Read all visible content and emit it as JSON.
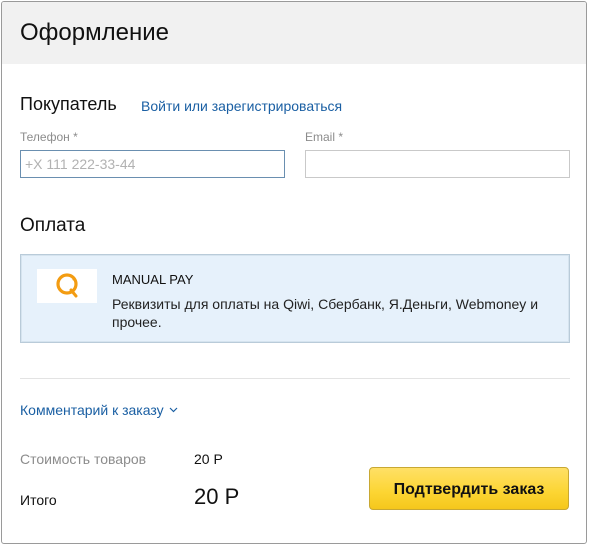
{
  "header": {
    "title": "Оформление"
  },
  "buyer": {
    "title": "Покупатель",
    "login_link": "Войти или зарегистрироваться",
    "phone": {
      "label": "Телефон *",
      "placeholder": "+X 111 222-33-44",
      "value": ""
    },
    "email": {
      "label": "Email *",
      "placeholder": "",
      "value": ""
    }
  },
  "payment": {
    "title": "Оплата",
    "method": {
      "logo_icon": "qiwi-logo",
      "name": "MANUAL PAY",
      "description": "Реквизиты для оплаты на Qiwi, Сбербанк, Я.Деньги, Webmoney и прочее."
    }
  },
  "comment": {
    "label": "Комментарий к заказу",
    "icon": "chevron-down-icon"
  },
  "summary": {
    "goods_label": "Стоимость товаров",
    "goods_value": "20 Р",
    "total_label": "Итого",
    "total_value": "20 Р"
  },
  "confirm_button": {
    "label": "Подтвердить заказ"
  },
  "colors": {
    "link": "#1a5fa3",
    "button": "#fcd532",
    "card_bg": "#e6f1fb",
    "header_bg": "#f1f1f1"
  }
}
